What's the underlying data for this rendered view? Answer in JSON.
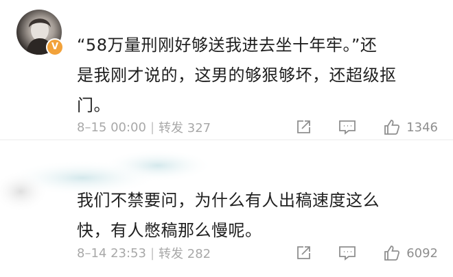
{
  "comments": [
    {
      "avatar": {
        "icon": "user-avatar",
        "badge_icon": "verified-v-badge",
        "badge_text": "V",
        "badge_color": "#f2a23a"
      },
      "text_lines": [
        "“58万量刑刚好够送我进去坐十年牢。”还",
        "是我刚才说的，这男的够狠够坏，还超级抠",
        "门。"
      ],
      "time": "8–15 00:00",
      "separator": "|",
      "repost": "转发 327",
      "likes": "1346"
    },
    {
      "text_lines": [
        "我们不禁要问，为什么有人出稿速度这么",
        "快，有人憋稿那么慢呢。"
      ],
      "time": "8–14 23:53",
      "separator": "|",
      "repost": "转发 282",
      "likes": "6092"
    }
  ],
  "icons": {
    "share": "share-icon",
    "comment": "comment-icon",
    "like": "thumbs-up-icon"
  },
  "colors": {
    "text": "#1f1f1f",
    "meta": "#a8a8a8",
    "icon": "#8e8e8e",
    "badge": "#f2a23a"
  }
}
